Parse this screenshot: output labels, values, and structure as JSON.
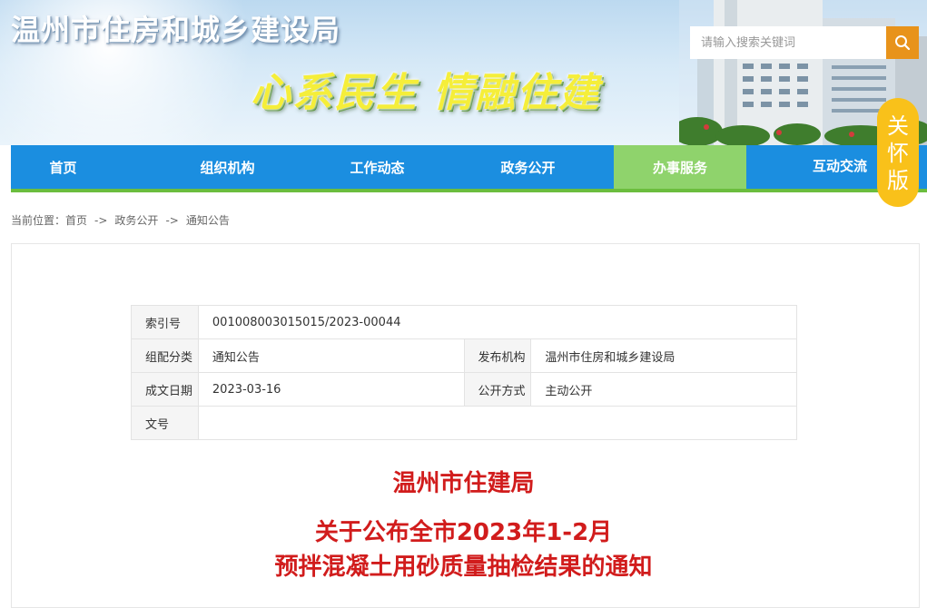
{
  "header": {
    "site_title": "温州市住房和城乡建设局",
    "slogan": "心系民生 情融住建",
    "search": {
      "placeholder": "请输入搜索关键词",
      "icon": "search-icon"
    }
  },
  "nav": {
    "items": [
      {
        "label": "首页"
      },
      {
        "label": "组织机构"
      },
      {
        "label": "工作动态"
      },
      {
        "label": "政务公开"
      },
      {
        "label": "办事服务",
        "active": true
      },
      {
        "label": "互动交流"
      }
    ]
  },
  "care_mode": {
    "label_1": "关",
    "label_2": "怀",
    "label_3": "版"
  },
  "breadcrumb": {
    "prefix": "当前位置：",
    "items": [
      "首页",
      "政务公开",
      "通知公告"
    ],
    "separator": "->"
  },
  "meta_table": {
    "index_label": "索引号",
    "index_value": "001008003015015/2023-00044",
    "category_label": "组配分类",
    "category_value": "通知公告",
    "publisher_label": "发布机构",
    "publisher_value": "温州市住房和城乡建设局",
    "date_label": "成文日期",
    "date_value": "2023-03-16",
    "open_label": "公开方式",
    "open_value": "主动公开",
    "docno_label": "文号",
    "docno_value": ""
  },
  "article": {
    "org": "温州市住建局",
    "title_line1": "关于公布全市2023年1-2月",
    "title_line2": "预拌混凝土用砂质量抽检结果的通知"
  },
  "colors": {
    "nav_blue": "#1b8ee0",
    "nav_active": "#8fd36c",
    "search_button": "#e8931b",
    "care_yellow": "#f9c11a",
    "title_red": "#d11c1c"
  }
}
